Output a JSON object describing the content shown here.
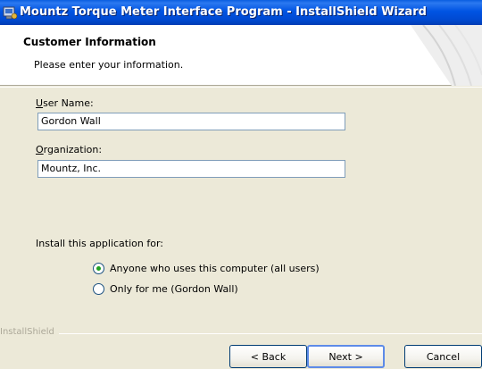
{
  "window": {
    "title": "Mountz Torque Meter Interface Program - InstallShield Wizard"
  },
  "header": {
    "title": "Customer Information",
    "subtitle": "Please enter your information."
  },
  "form": {
    "user_name_label_access": "U",
    "user_name_label_rest": "ser Name:",
    "user_name_value": "Gordon Wall",
    "organization_label_access": "O",
    "organization_label_rest": "rganization:",
    "organization_value": "Mountz, Inc."
  },
  "install_for": {
    "label": "Install this application for:",
    "options": [
      {
        "label": "Anyone who uses this computer (all users)",
        "selected": true
      },
      {
        "label": "Only for me (Gordon Wall)",
        "selected": false
      }
    ]
  },
  "footer": {
    "brand": "InstallShield",
    "back_label": "< Back",
    "next_label": "Next >",
    "cancel_label": "Cancel"
  }
}
